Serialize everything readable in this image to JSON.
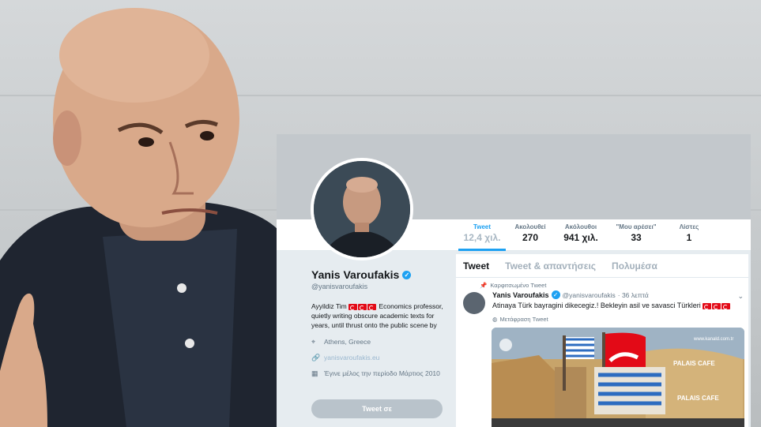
{
  "profile": {
    "name": "Yanis Varoufakis",
    "handle": "@yanisvaroufakis",
    "bio_prefix": "Ayyildiz Tim",
    "bio_suffix": "Economics professor, quietly writing obscure academic texts for years, until thrust onto the public scene by",
    "location": "Athens, Greece",
    "website": "yanisvaroufakis.eu",
    "joined": "Έγινε μέλος την περίοδο Μάρτιος 2010",
    "tweet_button": "Tweet σε"
  },
  "stats": [
    {
      "label": "Tweet",
      "value": "12,4 χιλ."
    },
    {
      "label": "Ακολουθεί",
      "value": "270"
    },
    {
      "label": "Ακόλουθοι",
      "value": "941 χιλ."
    },
    {
      "label": "\"Μου αρέσει\"",
      "value": "33"
    },
    {
      "label": "Λίστες",
      "value": "1"
    }
  ],
  "tabs": [
    "Tweet",
    "Tweet & απαντήσεις",
    "Πολυμέσα"
  ],
  "pinned_label": "Καρφιτσωμένο Tweet",
  "tweet": {
    "author": "Yanis Varoufakis",
    "handle": "@yanisvaroufakis",
    "time": "· 36 λεπτά",
    "text": "Atinaya Türk bayragini dikecegiz.! Bekleyin asil ve savasci Türkleri",
    "translate": "Μετάφραση Tweet",
    "media_watermark": "www.kanald.com.tr",
    "media_signs": [
      "PALAIS CAFE",
      "PALAIS CAFE"
    ]
  },
  "colors": {
    "accent": "#1da1f2",
    "turkish_red": "#e30a17"
  }
}
